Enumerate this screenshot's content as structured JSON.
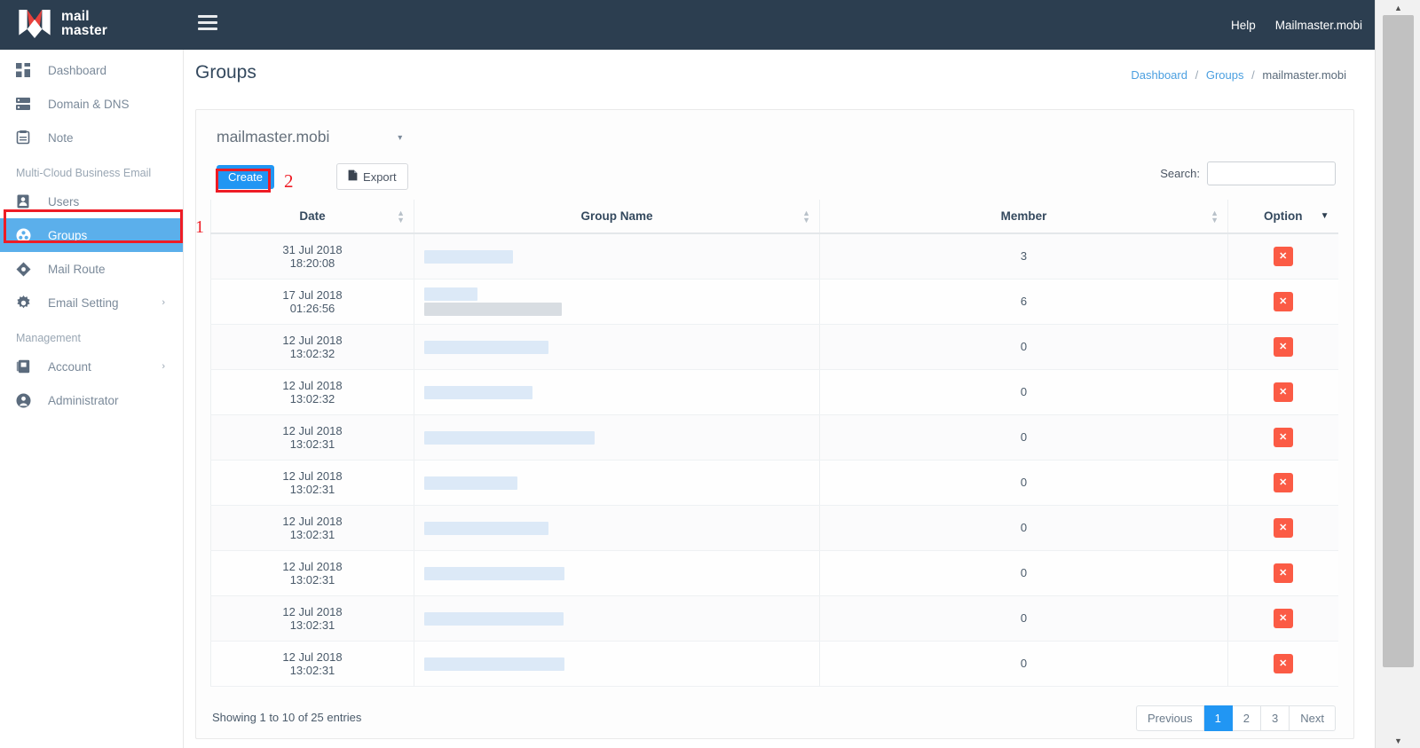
{
  "topbar": {
    "brand_line1": "mail",
    "brand_line2": "master",
    "menu_icon": "hamburger-icon",
    "links": [
      {
        "label": "Help"
      },
      {
        "label": "Mailmaster.mobi"
      }
    ]
  },
  "sidebar": {
    "items": [
      {
        "label": "Dashboard",
        "icon": "grid-dashboard-icon",
        "active": false,
        "expandable": false
      },
      {
        "label": "Domain & DNS",
        "icon": "server-icon",
        "active": false,
        "expandable": false
      },
      {
        "label": "Note",
        "icon": "clipboard-icon",
        "active": false,
        "expandable": false
      }
    ],
    "section1_label": "Multi-Cloud Business Email",
    "items2": [
      {
        "label": "Users",
        "icon": "user-card-icon",
        "active": false,
        "expandable": false
      },
      {
        "label": "Groups",
        "icon": "group-icon",
        "active": true,
        "expandable": false
      },
      {
        "label": "Mail Route",
        "icon": "route-diamond-icon",
        "active": false,
        "expandable": false
      },
      {
        "label": "Email Setting",
        "icon": "gear-icon",
        "active": false,
        "expandable": true
      }
    ],
    "section2_label": "Management",
    "items3": [
      {
        "label": "Account",
        "icon": "book-icon",
        "active": false,
        "expandable": true
      },
      {
        "label": "Administrator",
        "icon": "admin-user-icon",
        "active": false,
        "expandable": false
      }
    ]
  },
  "page": {
    "title": "Groups",
    "breadcrumb": [
      {
        "label": "Dashboard",
        "link": true
      },
      {
        "label": "Groups",
        "link": true
      },
      {
        "label": "mailmaster.mobi",
        "link": false
      }
    ],
    "breadcrumb_separator": "/"
  },
  "toolbar": {
    "domain_selected": "mailmaster.mobi",
    "domain_caret": "▾",
    "create_label": "Create",
    "export_label": "Export",
    "export_icon": "file-icon",
    "search_label": "Search:",
    "search_value": "",
    "search_placeholder": ""
  },
  "annotations": [
    {
      "number": "1",
      "target": "sidebar-item-groups",
      "color": "#ee1c25"
    },
    {
      "number": "2",
      "target": "create-button",
      "color": "#ee1c25"
    }
  ],
  "table": {
    "columns": [
      {
        "label": "Date",
        "sortable": true,
        "sort_state": "none"
      },
      {
        "label": "Group Name",
        "sortable": true,
        "sort_state": "none"
      },
      {
        "label": "Member",
        "sortable": true,
        "sort_state": "none"
      },
      {
        "label": "Option",
        "sortable": true,
        "sort_state": "desc"
      }
    ],
    "rows": [
      {
        "date": "31 Jul 2018",
        "time": "18:20:08",
        "group_name": "",
        "group_name_redacted": true,
        "redact_width": 100,
        "redact_second": false,
        "member": "3",
        "delete_icon": "close-x-icon"
      },
      {
        "date": "17 Jul 2018",
        "time": "01:26:56",
        "group_name": "",
        "group_name_redacted": true,
        "redact_width": 60,
        "redact_second": true,
        "redact2_width": 155,
        "member": "6",
        "delete_icon": "close-x-icon"
      },
      {
        "date": "12 Jul 2018",
        "time": "13:02:32",
        "group_name": "",
        "group_name_redacted": true,
        "redact_width": 140,
        "redact_second": false,
        "member": "0",
        "delete_icon": "close-x-icon"
      },
      {
        "date": "12 Jul 2018",
        "time": "13:02:32",
        "group_name": "",
        "group_name_redacted": true,
        "redact_width": 122,
        "redact_second": false,
        "member": "0",
        "delete_icon": "close-x-icon"
      },
      {
        "date": "12 Jul 2018",
        "time": "13:02:31",
        "group_name": "",
        "group_name_redacted": true,
        "redact_width": 192,
        "redact_second": false,
        "member": "0",
        "delete_icon": "close-x-icon"
      },
      {
        "date": "12 Jul 2018",
        "time": "13:02:31",
        "group_name": "",
        "group_name_redacted": true,
        "redact_width": 105,
        "redact_second": false,
        "member": "0",
        "delete_icon": "close-x-icon"
      },
      {
        "date": "12 Jul 2018",
        "time": "13:02:31",
        "group_name": "",
        "group_name_redacted": true,
        "redact_width": 140,
        "redact_second": false,
        "member": "0",
        "delete_icon": "close-x-icon"
      },
      {
        "date": "12 Jul 2018",
        "time": "13:02:31",
        "group_name": "",
        "group_name_redacted": true,
        "redact_width": 158,
        "redact_second": false,
        "member": "0",
        "delete_icon": "close-x-icon"
      },
      {
        "date": "12 Jul 2018",
        "time": "13:02:31",
        "group_name": "",
        "group_name_redacted": true,
        "redact_width": 157,
        "redact_second": false,
        "member": "0",
        "delete_icon": "close-x-icon"
      },
      {
        "date": "12 Jul 2018",
        "time": "13:02:31",
        "group_name": "",
        "group_name_redacted": true,
        "redact_width": 158,
        "redact_second": false,
        "member": "0",
        "delete_icon": "close-x-icon"
      }
    ]
  },
  "footer": {
    "info": "Showing 1 to 10 of 25 entries",
    "pagination": [
      {
        "label": "Previous",
        "active": false
      },
      {
        "label": "1",
        "active": true
      },
      {
        "label": "2",
        "active": false
      },
      {
        "label": "3",
        "active": false
      },
      {
        "label": "Next",
        "active": false
      }
    ]
  },
  "colors": {
    "topbar_bg": "#2c3e50",
    "sidebar_active": "#5bafeb",
    "primary_blue": "#2196f3",
    "danger_red": "#fb5b45",
    "annotation_red": "#ee1c25",
    "link_blue": "#4a9fe0"
  },
  "watermark": {
    "text": "mail master"
  }
}
